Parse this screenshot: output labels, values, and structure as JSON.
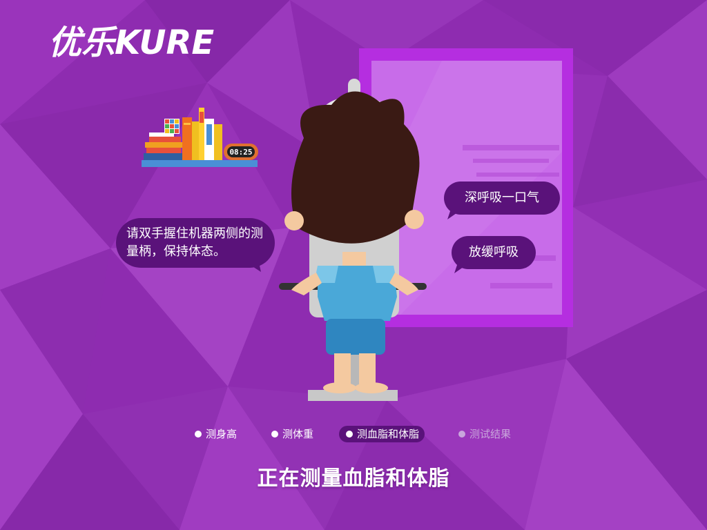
{
  "logo": {
    "text": "优乐KURE"
  },
  "clock": {
    "time": "08:25"
  },
  "bubbles": {
    "instruction": "请双手握住机器两侧的测量柄，保持体态。",
    "breathe_deep": "深呼吸一口气",
    "breathe_slow": "放缓呼吸"
  },
  "steps": [
    {
      "label": "测身高",
      "state": "done"
    },
    {
      "label": "测体重",
      "state": "done"
    },
    {
      "label": "测血脂和体脂",
      "state": "active"
    },
    {
      "label": "测试结果",
      "state": "pending"
    }
  ],
  "status": {
    "title": "正在测量血脂和体脂"
  },
  "colors": {
    "background": "#8e2cb0",
    "bubble": "#5a127a",
    "pending": "#c9a6dc",
    "frame": "#b52ee0"
  }
}
